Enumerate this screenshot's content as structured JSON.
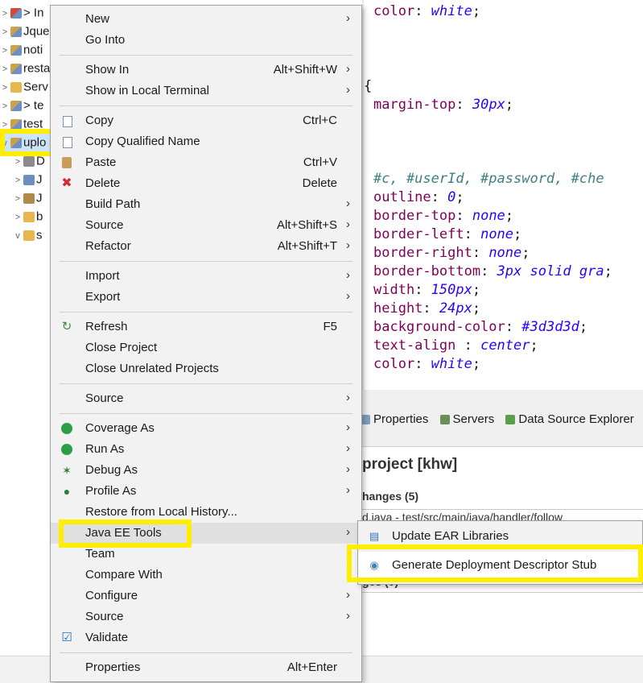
{
  "tree": {
    "items": [
      {
        "twisty": ">",
        "icon": "project-red-icon",
        "label": "> In"
      },
      {
        "twisty": ">",
        "icon": "project-icon",
        "label": "Jque"
      },
      {
        "twisty": ">",
        "icon": "project-icon",
        "label": "noti"
      },
      {
        "twisty": ">",
        "icon": "project-icon",
        "label": "resta"
      },
      {
        "twisty": ">",
        "icon": "folder-icon",
        "label": "Serv"
      },
      {
        "twisty": ">",
        "icon": "project-icon",
        "label": "> te"
      },
      {
        "twisty": ">",
        "icon": "project-icon",
        "label": "test"
      },
      {
        "twisty": "v",
        "icon": "project-icon",
        "label": "uplo"
      },
      {
        "twisty": ">",
        "icon": "library-icon",
        "label": "D"
      },
      {
        "twisty": ">",
        "icon": "web-icon",
        "label": "J"
      },
      {
        "twisty": ">",
        "icon": "jar-icon",
        "label": "J"
      },
      {
        "twisty": ">",
        "icon": "folder-icon",
        "label": "b"
      },
      {
        "twisty": "v",
        "icon": "folder-icon",
        "label": "s"
      }
    ],
    "bottom_label": "upload"
  },
  "editor": {
    "lines": [
      {
        "prop": "color",
        "value": "white"
      },
      {
        "brace": "{"
      },
      {
        "prop": "margin-top",
        "value": "30px"
      },
      {
        "selector": "#c, #userId, #password, #che"
      },
      {
        "prop": "outline",
        "value": "0"
      },
      {
        "prop": "border-top",
        "value": "none"
      },
      {
        "prop": "border-left",
        "value": "none"
      },
      {
        "prop": "border-right",
        "value": "none"
      },
      {
        "prop": "border-bottom",
        "value": "3px solid gra"
      },
      {
        "prop": "width",
        "value": "150px"
      },
      {
        "prop": "height",
        "value": "24px"
      },
      {
        "prop": "background-color",
        "value": "#3d3d3d"
      },
      {
        "prop": "text-align ",
        "value": "center"
      },
      {
        "prop": "color",
        "value": "white"
      }
    ]
  },
  "views": {
    "tabs": [
      "Properties",
      "Servers",
      "Data Source Explorer"
    ],
    "project_title": "project [khw]",
    "changes_heading": "hanges (5)",
    "changes_row": "d.java - test/src/main/java/handler/follow",
    "changes_heading2": "ges (0)"
  },
  "context_menu": {
    "groups": [
      [
        {
          "label": "New",
          "shortcut": "",
          "submenu": true,
          "icon": ""
        },
        {
          "label": "Go Into",
          "shortcut": "",
          "submenu": false,
          "icon": ""
        }
      ],
      [
        {
          "label": "Show In",
          "shortcut": "Alt+Shift+W",
          "submenu": true,
          "icon": ""
        },
        {
          "label": "Show in Local Terminal",
          "shortcut": "",
          "submenu": true,
          "icon": ""
        }
      ],
      [
        {
          "label": "Copy",
          "shortcut": "Ctrl+C",
          "submenu": false,
          "icon": "copy-icon"
        },
        {
          "label": "Copy Qualified Name",
          "shortcut": "",
          "submenu": false,
          "icon": "copy-icon"
        },
        {
          "label": "Paste",
          "shortcut": "Ctrl+V",
          "submenu": false,
          "icon": "paste-icon"
        },
        {
          "label": "Delete",
          "shortcut": "Delete",
          "submenu": false,
          "icon": "delete-icon"
        },
        {
          "label": "Build Path",
          "shortcut": "",
          "submenu": true,
          "icon": ""
        },
        {
          "label": "Source",
          "shortcut": "Alt+Shift+S",
          "submenu": true,
          "icon": ""
        },
        {
          "label": "Refactor",
          "shortcut": "Alt+Shift+T",
          "submenu": true,
          "icon": ""
        }
      ],
      [
        {
          "label": "Import",
          "shortcut": "",
          "submenu": true,
          "icon": ""
        },
        {
          "label": "Export",
          "shortcut": "",
          "submenu": true,
          "icon": ""
        }
      ],
      [
        {
          "label": "Refresh",
          "shortcut": "F5",
          "submenu": false,
          "icon": "refresh-icon"
        },
        {
          "label": "Close Project",
          "shortcut": "",
          "submenu": false,
          "icon": ""
        },
        {
          "label": "Close Unrelated Projects",
          "shortcut": "",
          "submenu": false,
          "icon": ""
        }
      ],
      [
        {
          "label": "Source",
          "shortcut": "",
          "submenu": true,
          "icon": ""
        }
      ],
      [
        {
          "label": "Coverage As",
          "shortcut": "",
          "submenu": true,
          "icon": "coverage-icon"
        },
        {
          "label": "Run As",
          "shortcut": "",
          "submenu": true,
          "icon": "run-icon"
        },
        {
          "label": "Debug As",
          "shortcut": "",
          "submenu": true,
          "icon": "debug-icon"
        },
        {
          "label": "Profile As",
          "shortcut": "",
          "submenu": true,
          "icon": "profile-icon"
        },
        {
          "label": "Restore from Local History...",
          "shortcut": "",
          "submenu": false,
          "icon": ""
        },
        {
          "label": "Java EE Tools",
          "shortcut": "",
          "submenu": true,
          "icon": ""
        },
        {
          "label": "Team",
          "shortcut": "",
          "submenu": true,
          "icon": ""
        },
        {
          "label": "Compare With",
          "shortcut": "",
          "submenu": true,
          "icon": ""
        },
        {
          "label": "Configure",
          "shortcut": "",
          "submenu": true,
          "icon": ""
        },
        {
          "label": "Source",
          "shortcut": "",
          "submenu": true,
          "icon": ""
        },
        {
          "label": "Validate",
          "shortcut": "",
          "submenu": false,
          "icon": "check-icon"
        }
      ],
      [
        {
          "label": "Properties",
          "shortcut": "Alt+Enter",
          "submenu": false,
          "icon": ""
        }
      ]
    ]
  },
  "submenu": {
    "items": [
      {
        "label": "Update EAR Libraries",
        "icon": "ear-library-icon"
      },
      {
        "label": "Generate Deployment Descriptor Stub",
        "icon": "descriptor-icon"
      }
    ]
  },
  "highlight_color": "#ffee00"
}
